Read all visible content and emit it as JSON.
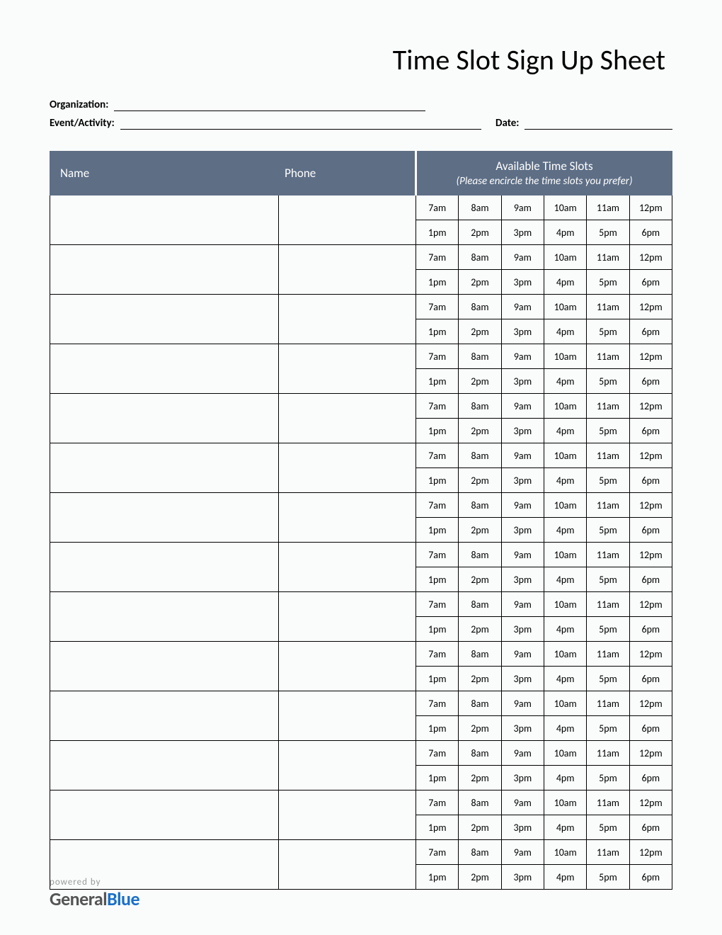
{
  "title": "Time Slot Sign Up Sheet",
  "meta": {
    "organization_label": "Organization:",
    "event_label": "Event/Activity:",
    "date_label": "Date:",
    "organization_value": "",
    "event_value": "",
    "date_value": ""
  },
  "table": {
    "headers": {
      "name": "Name",
      "phone": "Phone",
      "slots_title": "Available Time Slots",
      "slots_subtitle": "(Please encircle the time slots you prefer)"
    },
    "time_slots_row1": [
      "7am",
      "8am",
      "9am",
      "10am",
      "11am",
      "12pm"
    ],
    "time_slots_row2": [
      "1pm",
      "2pm",
      "3pm",
      "4pm",
      "5pm",
      "6pm"
    ],
    "num_entries": 14
  },
  "footer": {
    "powered_by": "powered by",
    "brand_general": "General",
    "brand_blue": "Blue"
  }
}
